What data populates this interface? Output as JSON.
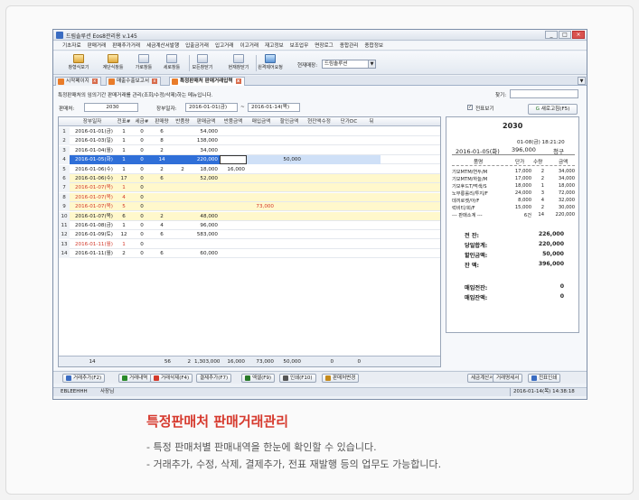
{
  "window": {
    "title": "드림솔루션 Eos8관리용 v.145",
    "btn_min": "_",
    "btn_max": "□",
    "btn_close": "×"
  },
  "menu": [
    "기초자료",
    "판매거래",
    "판매추가거래",
    "세금계산서발행",
    "입출금거래",
    "입고거래",
    "이고거래",
    "재고정보",
    "보조업무",
    "면장로그",
    "종합관리",
    "종합정보"
  ],
  "toolbar": {
    "buttons": [
      "창형식보기",
      "계단식창틀",
      "가로창틀",
      "세로창틀",
      "모든창닫기",
      "현재창닫기",
      "원격제어요청"
    ],
    "biz_label": "현재매장:",
    "biz_value": "드림솔루션"
  },
  "tabs": [
    {
      "label": "시작페이지"
    },
    {
      "label": "매출수출보고서"
    },
    {
      "label": "특정판매처 판매거래입력"
    }
  ],
  "form": {
    "desc": "특정판매처의 임의기간 판매거래를 관리(조회/수정/삭제)하는 메뉴입니다.",
    "search_label": "찾기:",
    "seller_label": "판매처:",
    "seller_value": "2030",
    "period_label": "장부일자:",
    "date_from": "2016-01-01(금)",
    "tilde": "~",
    "date_to": "2016-01-14(목)",
    "print_preview": "전표보기",
    "check_mark": "✓",
    "refresh": "새로고침(F5)"
  },
  "grid": {
    "headers": [
      "",
      "장부일자",
      "전표#",
      "세금#",
      "판매량",
      "반품량",
      "판매금액",
      "반품금액",
      "매입금액",
      "할인금액",
      "현잔액수정",
      "단가DC",
      "뒤"
    ],
    "rows": [
      [
        "1",
        "2016-01-01(금)",
        "1",
        "0",
        "6",
        "",
        "54,000",
        "",
        "",
        "",
        "",
        "",
        ""
      ],
      [
        "2",
        "2016-01-03(일)",
        "1",
        "0",
        "8",
        "",
        "138,000",
        "",
        "",
        "",
        "",
        "",
        ""
      ],
      [
        "3",
        "2016-01-04(월)",
        "1",
        "0",
        "2",
        "",
        "34,000",
        "",
        "",
        "",
        "",
        "",
        ""
      ],
      [
        "4",
        "2016-01-05(화)",
        "1",
        "0",
        "14",
        "",
        "220,000",
        "",
        "",
        "50,000",
        "",
        "",
        ""
      ],
      [
        "5",
        "2016-01-06(수)",
        "1",
        "0",
        "2",
        "2",
        "18,000",
        "16,000",
        "",
        "",
        "",
        "",
        ""
      ],
      [
        "6",
        "2016-01-06(수)",
        "17",
        "0",
        "6",
        "",
        "52,000",
        "",
        "",
        "",
        "",
        "",
        ""
      ],
      [
        "7",
        "2016-01-07(목)",
        "1",
        "0",
        "",
        "",
        "",
        "",
        "",
        "",
        "",
        "",
        ""
      ],
      [
        "8",
        "2016-01-07(목)",
        "4",
        "0",
        "",
        "",
        "",
        "",
        "",
        "",
        "",
        "",
        ""
      ],
      [
        "9",
        "2016-01-07(목)",
        "5",
        "0",
        "",
        "",
        "",
        "",
        "73,000",
        "",
        "",
        "",
        ""
      ],
      [
        "10",
        "2016-01-07(목)",
        "6",
        "0",
        "2",
        "",
        "48,000",
        "",
        "",
        "",
        "",
        "",
        ""
      ],
      [
        "11",
        "2016-01-08(금)",
        "1",
        "0",
        "4",
        "",
        "96,000",
        "",
        "",
        "",
        "",
        "",
        ""
      ],
      [
        "12",
        "2016-01-09(토)",
        "12",
        "0",
        "6",
        "",
        "583,000",
        "",
        "",
        "",
        "",
        "",
        ""
      ],
      [
        "13",
        "2016-01-11(월)",
        "1",
        "0",
        "",
        "",
        "",
        "",
        "",
        "",
        "",
        "",
        ""
      ],
      [
        "14",
        "2016-01-11(월)",
        "2",
        "0",
        "6",
        "",
        "60,000",
        "",
        "",
        "",
        "",
        "",
        ""
      ]
    ],
    "footer": [
      "",
      "14",
      "",
      "56",
      "2",
      "1,303,000",
      "16,000",
      "73,000",
      "50,000",
      "0",
      "0",
      ""
    ]
  },
  "receipt": {
    "store": "2030",
    "printed_at": "01-08(금) 18:21:20",
    "date": "2016-01-05(화)",
    "total_top": "396,000",
    "type": "청구",
    "col_item": "품명",
    "col_price": "단가",
    "col_qty": "수량",
    "col_amount": "금액",
    "items": [
      [
        "기모MTM/연두/M",
        "17,000",
        "2",
        "34,000"
      ],
      [
        "기모MTM/하늘/M",
        "17,000",
        "2",
        "34,000"
      ],
      [
        "기모후드T/먹색/S",
        "18,000",
        "1",
        "18,000"
      ],
      [
        "노부롱롤리/투지/F",
        "24,000",
        "3",
        "72,000"
      ],
      [
        "데끼로켓/아/F",
        "8,000",
        "4",
        "32,000"
      ],
      [
        "럭비티/회/F",
        "15,000",
        "2",
        "30,000"
      ]
    ],
    "subtotal": [
      "--- 판매소계 ---",
      "6건",
      "14",
      "220,000"
    ],
    "sum_rows": [
      [
        "전       잔:",
        "226,000"
      ],
      [
        "당일합계:",
        "220,000"
      ],
      [
        "할인금액:",
        "50,000"
      ],
      [
        "잔       액:",
        "396,000"
      ]
    ],
    "buy_rows": [
      [
        "매입전잔:",
        "0"
      ],
      [
        "매입잔액:",
        "0"
      ]
    ]
  },
  "bottom_buttons": [
    "거래추가(F2)",
    "거래내역",
    "거래삭제(F4)",
    "결제추가(F7)",
    "엑셀(F9)",
    "인쇄(F10)",
    "판매처변경",
    "세금계산서",
    "거래명세서",
    "전표인쇄"
  ],
  "status": {
    "user": "EBLEEHHH",
    "role": "사장님",
    "datetime": "2016-01-14(목) 14:38:18"
  },
  "caption": {
    "title": "특정판매처 판매거래관리",
    "line1": "- 특정 판매처별 판매내역을 한눈에 확인할 수 있습니다.",
    "line2": "- 거래추가, 수정, 삭제, 결제추가, 전표 재발행 등의 업무도 가능합니다."
  },
  "colors": {
    "selected_row": "#2f6fd8",
    "yellow_row": "#fff8cc",
    "red_text": "#d33a2b",
    "caption_red": "#d63a2e"
  }
}
